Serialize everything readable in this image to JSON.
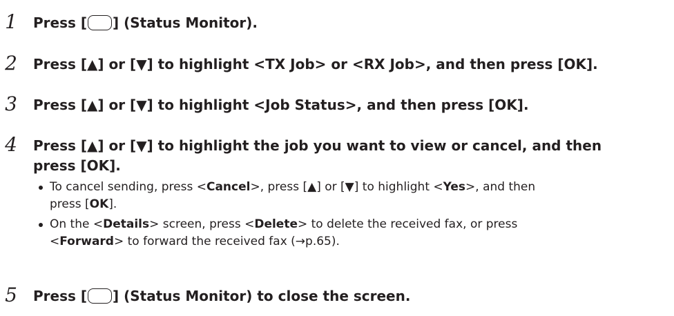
{
  "steps": [
    {
      "number": "1",
      "pre": "Press [",
      "post": "] (Status Monitor)."
    },
    {
      "number": "2",
      "text": "Press [▲] or [▼] to highlight <TX Job> or <RX Job>, and then press [OK]."
    },
    {
      "number": "3",
      "text": "Press [▲] or [▼] to highlight <Job Status>, and then press [OK]."
    },
    {
      "number": "4",
      "line1": "Press [▲] or [▼] to highlight the job you want to view or cancel, and then",
      "line2": "press [OK].",
      "bullets": [
        {
          "t1": "To cancel sending, press <",
          "b1": "Cancel",
          "t2": ">, press [▲] or [▼] to highlight <",
          "b2": "Yes",
          "t3": ">, and then",
          "t4": "press [",
          "b3": "OK",
          "t5": "]."
        },
        {
          "t1": "On the <",
          "b1": "Details",
          "t2": "> screen, press <",
          "b2": "Delete",
          "t3": "> to delete the received fax, or press",
          "t4": "<",
          "b3": "Forward",
          "t5": "> to forward the received fax (→p.65)."
        }
      ]
    },
    {
      "number": "5",
      "pre": "Press [",
      "post": "] (Status Monitor) to close the screen."
    }
  ]
}
